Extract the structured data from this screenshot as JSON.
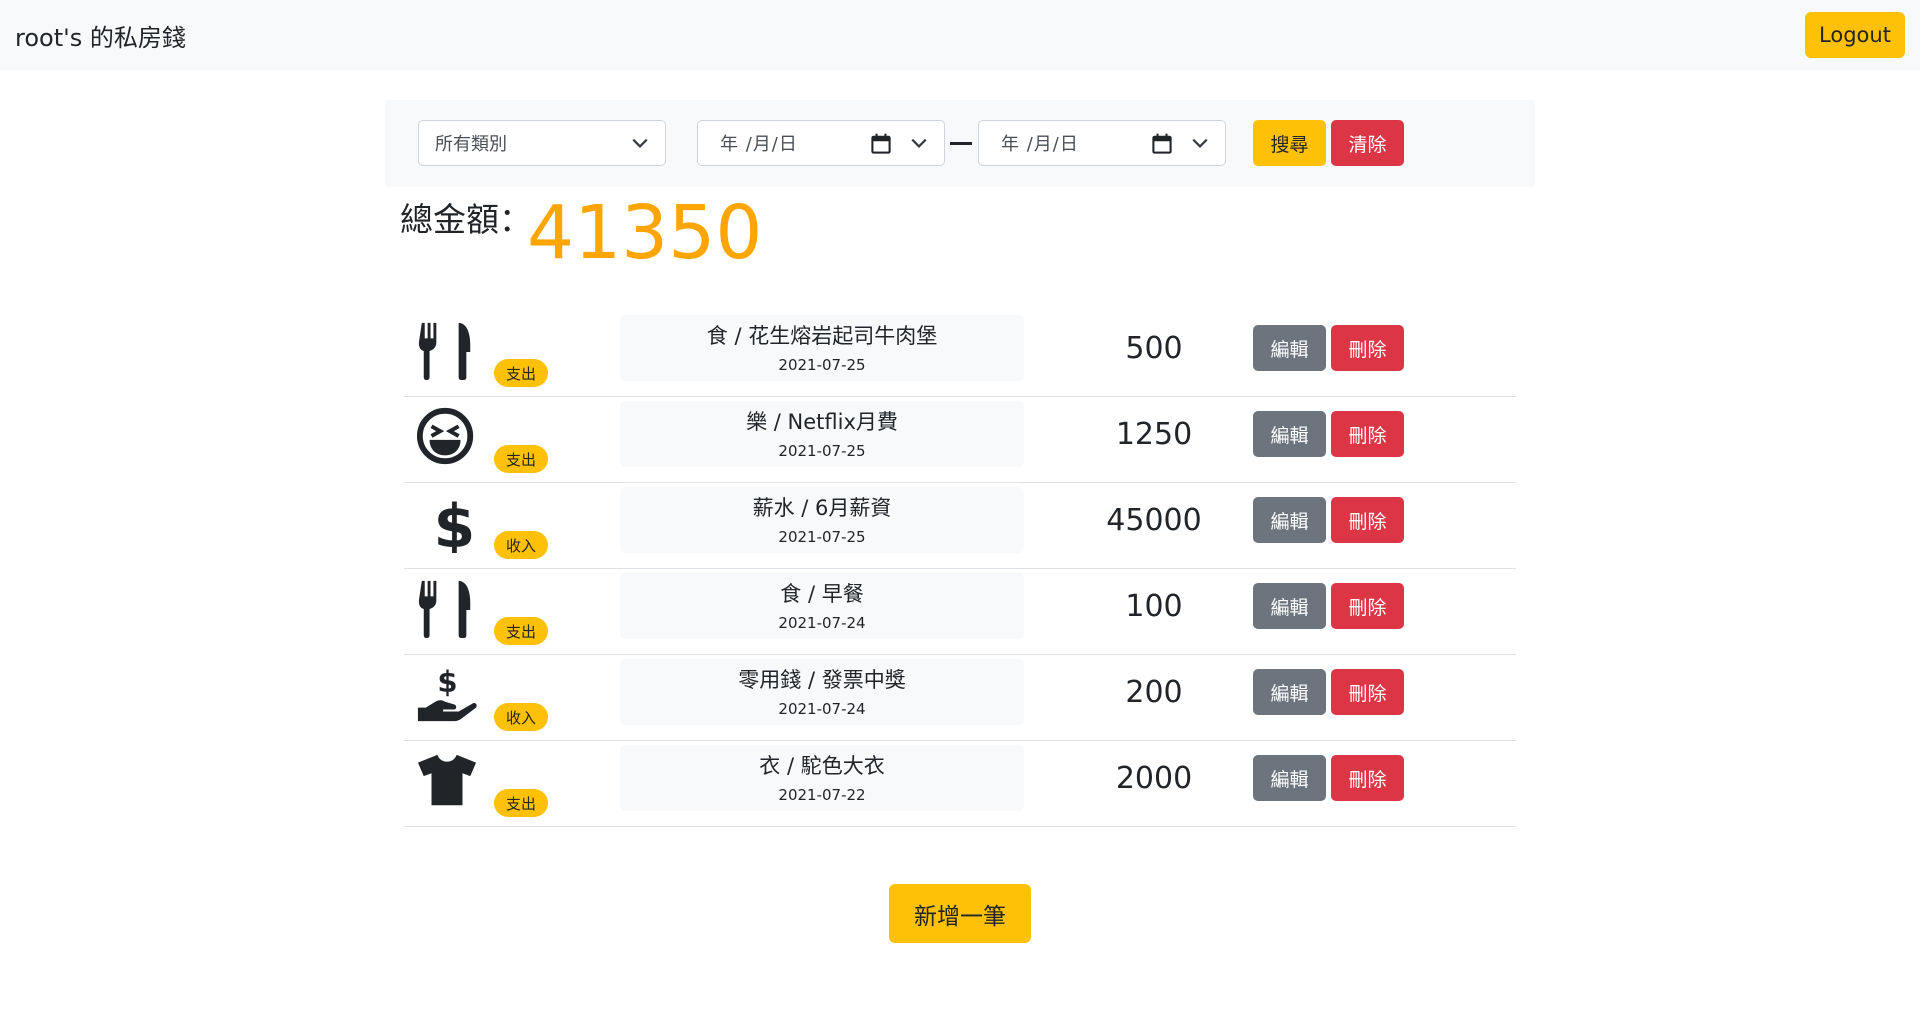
{
  "navbar": {
    "brand": "root's 的私房錢",
    "logout_label": "Logout"
  },
  "filter": {
    "category_selected": "所有類別",
    "date_from_placeholder": "年 /月/日",
    "date_to_placeholder": "年 /月/日",
    "search_label": "搜尋",
    "clear_label": "清除"
  },
  "summary": {
    "total_label": "總金額：",
    "total_value": "41350"
  },
  "colors": {
    "accent": "#ffc107",
    "danger": "#dc3545",
    "secondary": "#6c757d",
    "total": "#ffa500"
  },
  "records": [
    {
      "icon": "utensils-icon",
      "type": "支出",
      "title": "食 / 花生熔岩起司牛肉堡",
      "date": "2021-07-25",
      "amount": "500",
      "edit_label": "編輯",
      "delete_label": "刪除"
    },
    {
      "icon": "laughing-face-icon",
      "type": "支出",
      "title": "樂 / Netflix月費",
      "date": "2021-07-25",
      "amount": "1250",
      "edit_label": "編輯",
      "delete_label": "刪除"
    },
    {
      "icon": "dollar-sign-icon",
      "type": "收入",
      "title": "薪水 / 6月薪資",
      "date": "2021-07-25",
      "amount": "45000",
      "edit_label": "編輯",
      "delete_label": "刪除"
    },
    {
      "icon": "utensils-icon",
      "type": "支出",
      "title": "食 / 早餐",
      "date": "2021-07-24",
      "amount": "100",
      "edit_label": "編輯",
      "delete_label": "刪除"
    },
    {
      "icon": "hand-holding-dollar-icon",
      "type": "收入",
      "title": "零用錢 / 發票中獎",
      "date": "2021-07-24",
      "amount": "200",
      "edit_label": "編輯",
      "delete_label": "刪除"
    },
    {
      "icon": "tshirt-icon",
      "type": "支出",
      "title": "衣 / 駝色大衣",
      "date": "2021-07-22",
      "amount": "2000",
      "edit_label": "編輯",
      "delete_label": "刪除"
    }
  ],
  "add_label": "新增一筆"
}
